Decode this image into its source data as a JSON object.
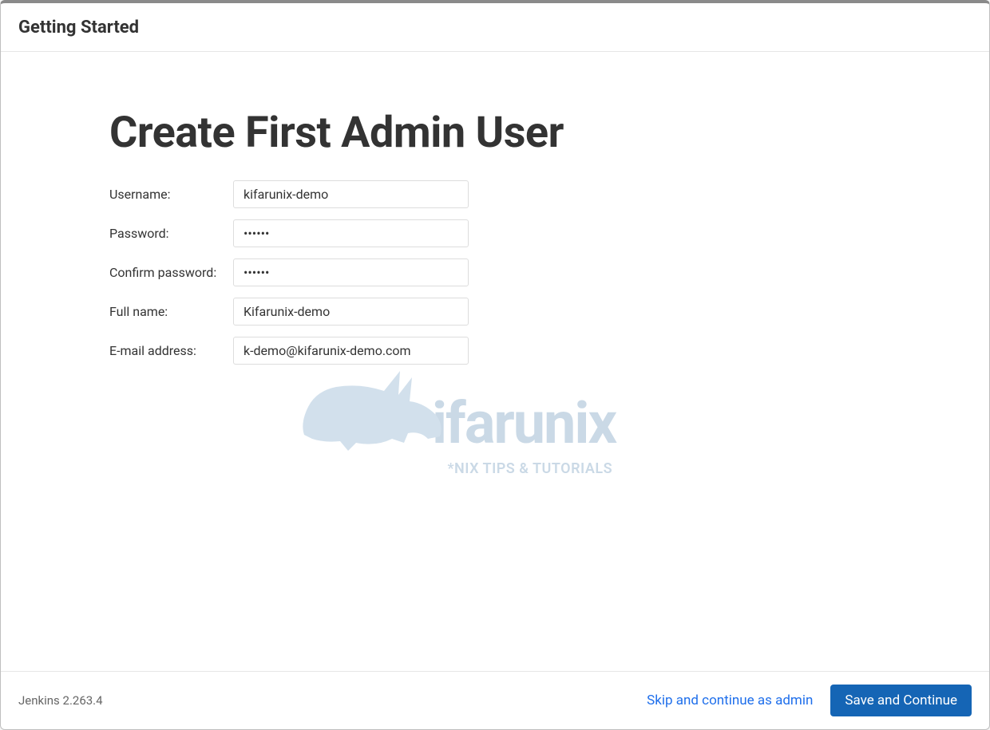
{
  "header": {
    "title": "Getting Started"
  },
  "main": {
    "heading": "Create First Admin User",
    "fields": {
      "username": {
        "label": "Username:",
        "value": "kifarunix-demo"
      },
      "password": {
        "label": "Password:",
        "value": "••••••"
      },
      "confirm_password": {
        "label": "Confirm password:",
        "value": "••••••"
      },
      "fullname": {
        "label": "Full name:",
        "value": "Kifarunix-demo"
      },
      "email": {
        "label": "E-mail address:",
        "value": "k-demo@kifarunix-demo.com"
      }
    }
  },
  "watermark": {
    "brand": "ifarunix",
    "tagline": "*NIX TIPS & TUTORIALS"
  },
  "footer": {
    "version": "Jenkins 2.263.4",
    "skip_label": "Skip and continue as admin",
    "save_label": "Save and Continue"
  }
}
